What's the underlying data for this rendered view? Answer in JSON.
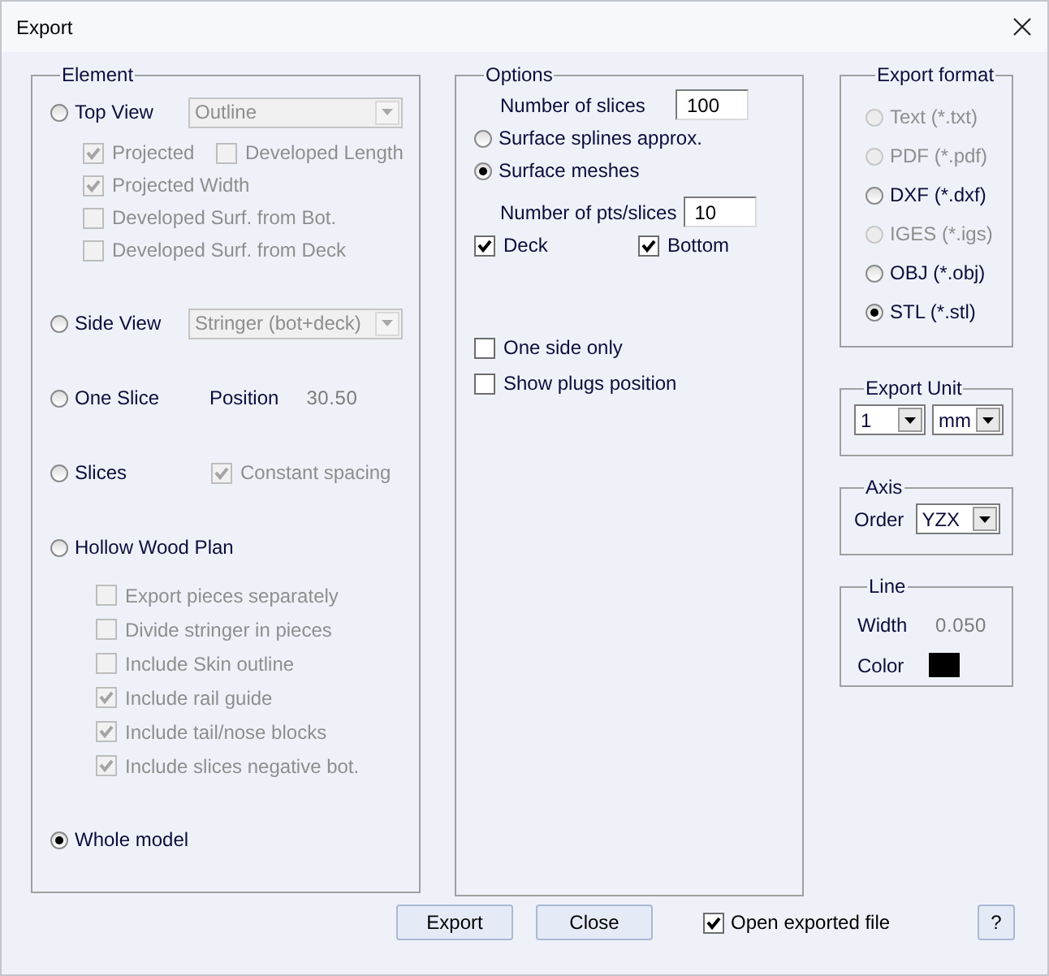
{
  "window": {
    "title": "Export"
  },
  "element": {
    "title": "Element",
    "entries": [
      {
        "label": "Top View",
        "selected": false,
        "dropdown": {
          "value": "Outline",
          "disabled": true
        },
        "suboptions": [
          [
            {
              "label": "Projected",
              "checked": true,
              "disabled": true
            },
            {
              "label": "Developed Length",
              "checked": false,
              "disabled": true
            }
          ],
          [
            {
              "label": "Projected Width",
              "checked": true,
              "disabled": true
            }
          ],
          [
            {
              "label": "Developed Surf. from Bot.",
              "checked": false,
              "disabled": true
            }
          ],
          [
            {
              "label": "Developed Surf. from Deck",
              "checked": false,
              "disabled": true
            }
          ]
        ]
      },
      {
        "label": "Side View",
        "selected": false,
        "dropdown": {
          "value": "Stringer (bot+deck)",
          "disabled": true
        }
      },
      {
        "label": "One Slice",
        "selected": false,
        "field": {
          "label": "Position",
          "value": "30.50"
        }
      },
      {
        "label": "Slices",
        "selected": false,
        "checkbox": {
          "label": "Constant spacing",
          "checked": true,
          "disabled": true
        }
      },
      {
        "label": "Hollow Wood Plan",
        "selected": false,
        "suboptions": [
          [
            {
              "label": "Export pieces separately",
              "checked": false,
              "disabled": true
            }
          ],
          [
            {
              "label": "Divide stringer in pieces",
              "checked": false,
              "disabled": true
            }
          ],
          [
            {
              "label": "Include Skin outline",
              "checked": false,
              "disabled": true
            }
          ],
          [
            {
              "label": "Include rail guide",
              "checked": true,
              "disabled": true
            }
          ],
          [
            {
              "label": "Include tail/nose blocks",
              "checked": true,
              "disabled": true
            }
          ],
          [
            {
              "label": "Include slices negative bot.",
              "checked": true,
              "disabled": true
            }
          ]
        ]
      },
      {
        "label": "Whole model",
        "selected": true
      }
    ]
  },
  "options": {
    "title": "Options",
    "items": [
      {
        "kind": "number",
        "label": "Number of slices",
        "value": "100"
      },
      {
        "kind": "radio",
        "label": "Surface splines approx.",
        "selected": false
      },
      {
        "kind": "radio",
        "label": "Surface meshes",
        "selected": true
      },
      {
        "kind": "number",
        "label": "Number of pts/slices",
        "value": "10"
      },
      {
        "kind": "checkboxes",
        "checkboxes": [
          {
            "label": "Deck",
            "checked": true
          },
          {
            "label": "Bottom",
            "checked": true
          }
        ]
      }
    ],
    "extras": [
      {
        "label": "One side only",
        "checked": false
      },
      {
        "label": "Show plugs position",
        "checked": false
      }
    ]
  },
  "export_format": {
    "title": "Export format",
    "formats": [
      {
        "label": "Text (*.txt)",
        "selected": false,
        "disabled": true
      },
      {
        "label": "PDF (*.pdf)",
        "selected": false,
        "disabled": true
      },
      {
        "label": "DXF (*.dxf)",
        "selected": false,
        "disabled": false
      },
      {
        "label": "IGES (*.igs)",
        "selected": false,
        "disabled": true
      },
      {
        "label": "OBJ (*.obj)",
        "selected": false,
        "disabled": false
      },
      {
        "label": "STL (*.stl)",
        "selected": true,
        "disabled": false
      }
    ]
  },
  "export_unit": {
    "title": "Export Unit",
    "dropdowns": [
      {
        "value": "1"
      },
      {
        "value": "mm"
      }
    ]
  },
  "axis": {
    "title": "Axis",
    "label": "Order",
    "dropdown": {
      "value": "YZX"
    }
  },
  "line": {
    "title": "Line",
    "width_label": "Width",
    "width_value": "0.050",
    "color_label": "Color",
    "color": "#000000"
  },
  "footer": {
    "buttons": [
      {
        "label": "Export"
      },
      {
        "label": "Close"
      }
    ],
    "checkbox": {
      "label": "Open exported file",
      "checked": true
    },
    "help": "?"
  }
}
